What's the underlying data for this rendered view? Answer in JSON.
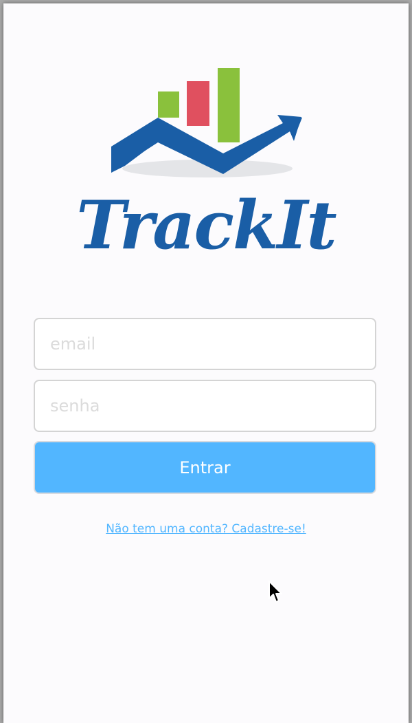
{
  "app": {
    "brand_name": "TrackIt"
  },
  "login_form": {
    "email_placeholder": "email",
    "password_placeholder": "senha",
    "submit_label": "Entrar",
    "signup_link": "Não tem uma conta? Cadastre-se!"
  },
  "colors": {
    "background": "#fcfbfd",
    "brand_blue": "#1a5ea6",
    "accent": "#52b6ff",
    "bar_green": "#8ac13c",
    "bar_red": "#e0505f",
    "input_border": "#d4d4d4"
  },
  "icons": {
    "logo": "trackit-chart-logo",
    "pointer": "mouse-pointer-icon"
  }
}
